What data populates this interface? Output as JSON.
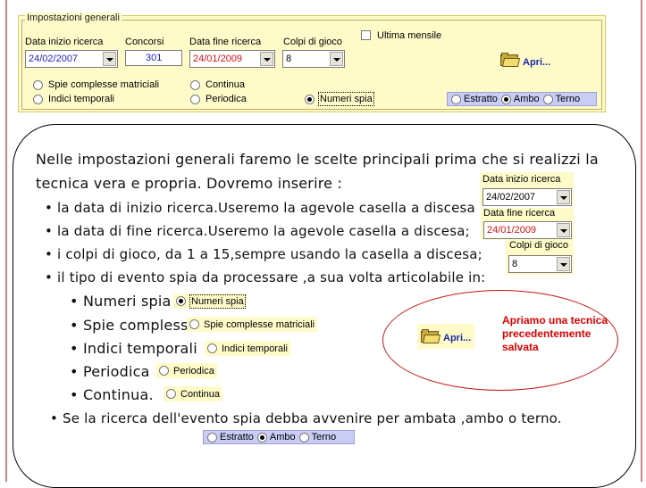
{
  "settings": {
    "legend": "Impostazioni generali",
    "start_date_label": "Data inizio ricerca",
    "start_date_value": "24/02/2007",
    "contests_label": "Concorsi",
    "contests_value": "301",
    "end_date_label": "Data fine ricerca",
    "end_date_value": "24/01/2009",
    "shots_label": "Colpi di gioco",
    "shots_value": "8",
    "last_monthly_label": "Ultima mensile",
    "open_label": "Apri...",
    "event_types": [
      "Spie complesse matriciali",
      "Indici temporali",
      "Continua",
      "Periodica",
      "Numeri spia"
    ],
    "outcomes": [
      "Estratto",
      "Ambo",
      "Terno"
    ],
    "colors": {
      "panel": "#fffbc9",
      "strip": "#c9cdf5",
      "start_date": "#2222c0",
      "end_date": "#d01010"
    }
  },
  "explanation": {
    "intro_line1": "Nelle impostazioni generali faremo le scelte principali prima che si realizzi la",
    "intro_line2": "tecnica vera e propria. Dovremo inserire :",
    "item1": "la data di inizio ricerca.Useremo la agevole casella a discesa",
    "item2": "la data di fine ricerca.Useremo la agevole casella a discesa;",
    "item3": "i colpi di gioco, da 1 a 15,sempre usando la casella a discesa;",
    "item4": "il tipo di evento spia da processare ,a sua volta articolabile in:",
    "sub1": "Numeri spia",
    "sub2": "Spie complesse",
    "sub3": "Indici temporali",
    "sub4": "Periodica",
    "sub5": "Continua.",
    "final": "Se la ricerca dell'evento spia debba avvenire per ambata ,ambo o terno.",
    "callout": "Apriamo una tecnica precedentemente salvata"
  }
}
